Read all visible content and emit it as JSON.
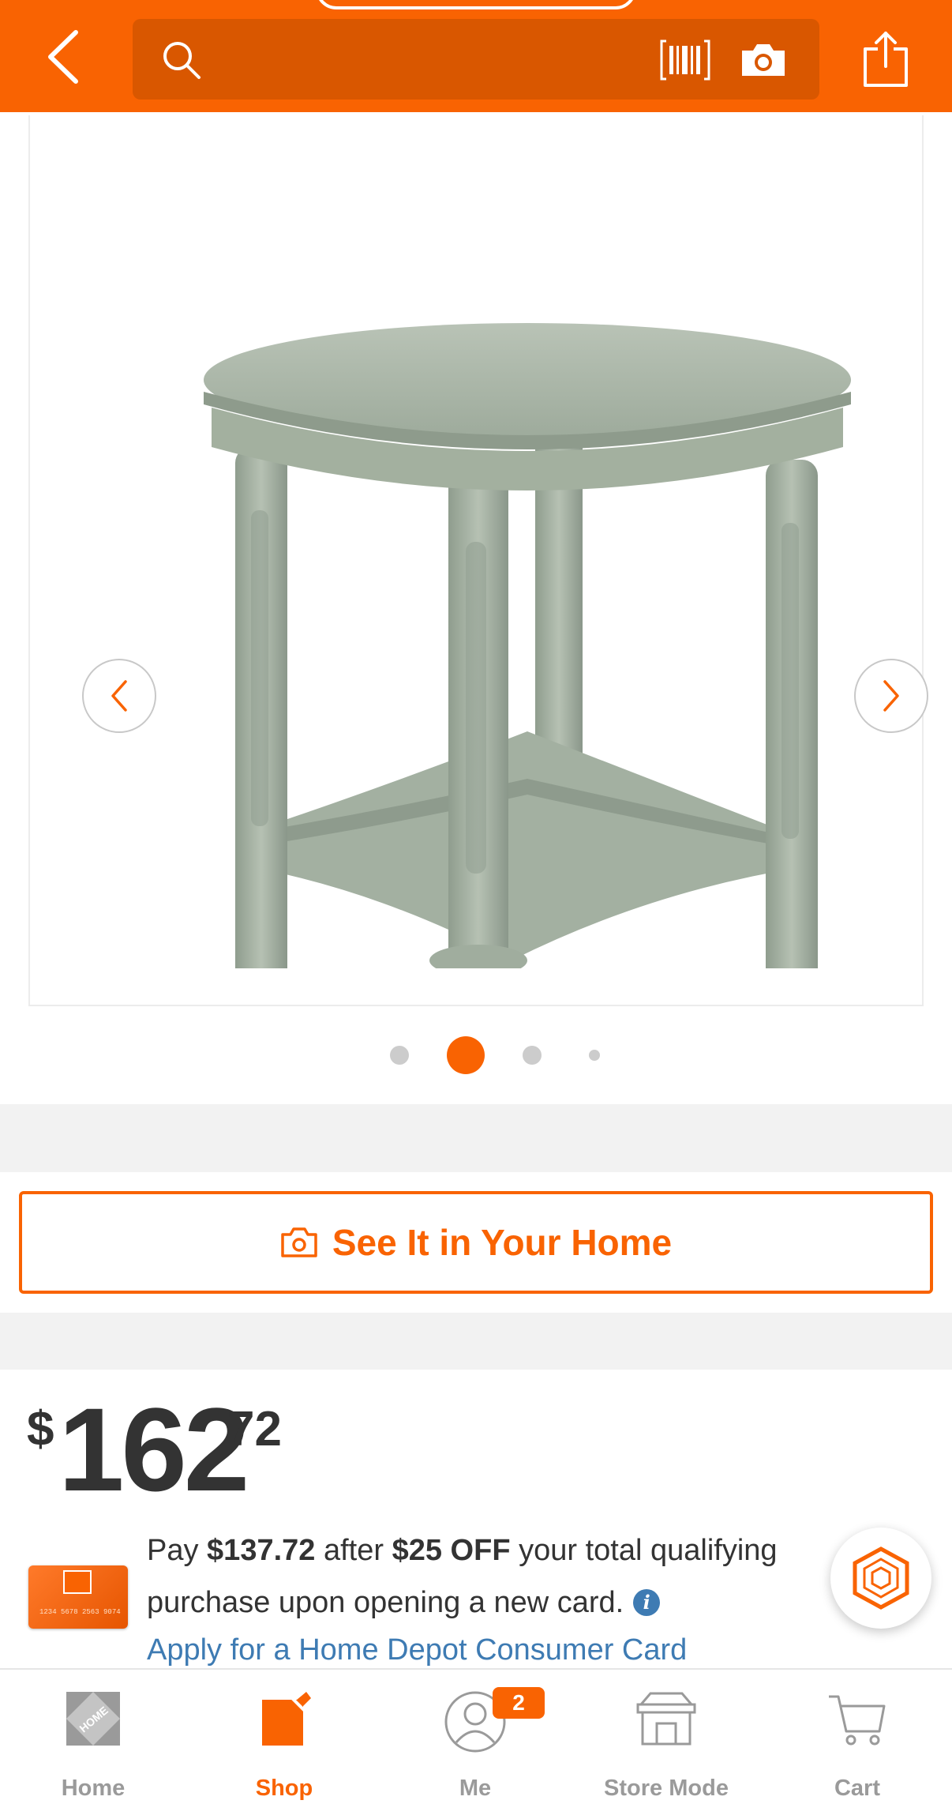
{
  "header": {
    "back_icon": "chevron-left-icon",
    "search_placeholder": "",
    "search_icon": "search-icon",
    "barcode_icon": "barcode-scan-icon",
    "camera_icon": "camera-icon",
    "share_icon": "share-icon"
  },
  "gallery": {
    "image_subject": "round antique sage green end table with shelf",
    "prev_icon": "chevron-left-icon",
    "next_icon": "chevron-right-icon",
    "page_count": 4,
    "active_index": 1
  },
  "ar_button": {
    "label": "See It in Your Home",
    "icon": "camera-icon"
  },
  "price": {
    "currency": "$",
    "dollars": "162",
    "cents": "72"
  },
  "offer": {
    "pay": "Pay",
    "amount": "$137.72",
    "after": "after",
    "discount": "$25 OFF",
    "text1": "your total qualifying",
    "text2": "purchase upon opening a new card.",
    "link": "Apply for a Home Depot Consumer Card",
    "card_number": "1234 5678 2563 9074"
  },
  "bottom_nav": {
    "items": [
      {
        "label": "Home",
        "icon": "home-depot-logo-icon"
      },
      {
        "label": "Shop",
        "icon": "shop-tag-icon"
      },
      {
        "label": "Me",
        "icon": "user-icon",
        "badge": "2"
      },
      {
        "label": "Store Mode",
        "icon": "store-icon"
      },
      {
        "label": "Cart",
        "icon": "cart-icon"
      }
    ],
    "active": "Shop"
  },
  "colors": {
    "brand_orange": "#f96302",
    "search_bg": "#d95700",
    "link_blue": "#3e7bb3",
    "table_green": "#a7b4a6"
  }
}
